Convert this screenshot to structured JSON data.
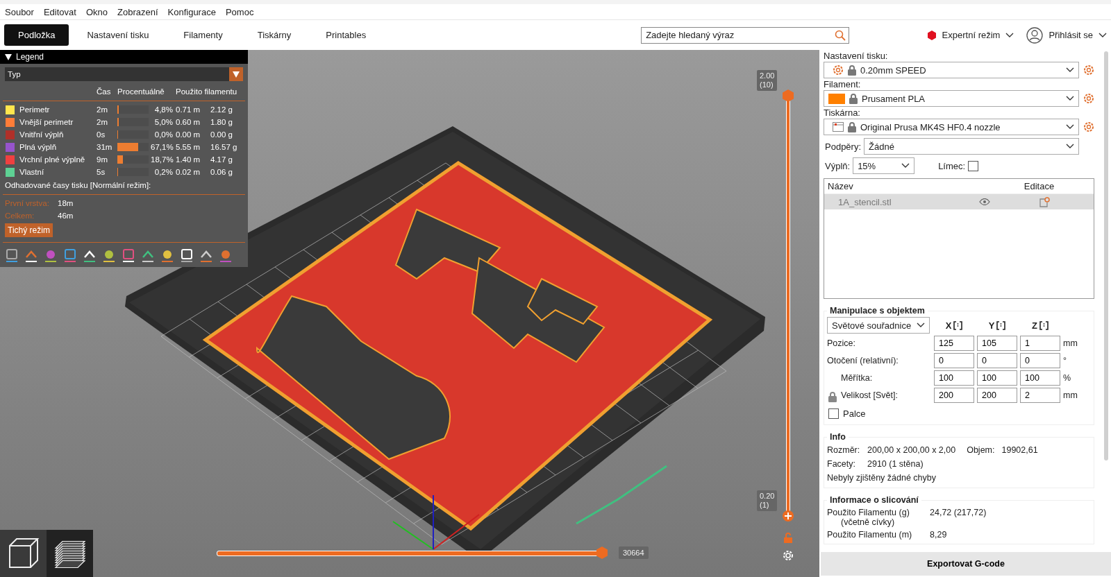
{
  "menu": [
    "Soubor",
    "Editovat",
    "Okno",
    "Zobrazení",
    "Konfigurace",
    "Pomoc"
  ],
  "tabs": [
    {
      "label": "Podložka",
      "selected": true
    },
    {
      "label": "Nastavení tisku",
      "selected": false
    },
    {
      "label": "Filamenty",
      "selected": false
    },
    {
      "label": "Tiskárny",
      "selected": false
    },
    {
      "label": "Printables",
      "selected": false
    }
  ],
  "search": {
    "placeholder": "Zadejte hledaný výraz"
  },
  "mode": {
    "label": "Expertní režim"
  },
  "login": {
    "label": "Přihlásit se"
  },
  "legend": {
    "title": "Legend",
    "view_type": "Typ",
    "columns": [
      "Čas",
      "Procentuálně",
      "Použito filamentu"
    ],
    "rows": [
      {
        "name": "Perimetr",
        "color": "#ffe64d",
        "time": "2m",
        "level": 0.048,
        "percent": "4,8%",
        "length": "0.71 m",
        "weight": "2.12 g"
      },
      {
        "name": "Vnější perimetr",
        "color": "#ff7d38",
        "time": "2m",
        "level": 0.05,
        "percent": "5,0%",
        "length": "0.60 m",
        "weight": "1.80 g"
      },
      {
        "name": "Vnitřní výplň",
        "color": "#b03029",
        "time": "0s",
        "level": 0.0,
        "percent": "0,0%",
        "length": "0.00 m",
        "weight": "0.00 g"
      },
      {
        "name": "Plná výplň",
        "color": "#9654cc",
        "time": "31m",
        "level": 0.671,
        "percent": "67,1%",
        "length": "5.55 m",
        "weight": "16.57 g"
      },
      {
        "name": "Vrchní plné výplně",
        "color": "#f04040",
        "time": "9m",
        "level": 0.187,
        "percent": "18,7%",
        "length": "1.40 m",
        "weight": "4.17 g"
      },
      {
        "name": "Vlastní",
        "color": "#5ed194",
        "time": "5s",
        "level": 0.002,
        "percent": "0,2%",
        "length": "0.02 m",
        "weight": "0.06 g"
      }
    ],
    "estimate_title": "Odhadované časy tisku [Normální režim]:",
    "times": [
      {
        "label": "První vrstva:",
        "value": "18m"
      },
      {
        "label": "Celkem:",
        "value": "46m"
      }
    ],
    "mode_button": "Tichý režim"
  },
  "layer_slider": {
    "handles": [
      {
        "level": 1,
        "label": [
          "2.00",
          "(10)"
        ]
      },
      {
        "level": 0,
        "label": [
          "0.20",
          "(1)"
        ]
      }
    ]
  },
  "move_slider": {
    "level": 1,
    "value": "30664"
  },
  "presets": [
    {
      "kind": "print",
      "label": "Nastavení tisku:",
      "value": "0.20mm SPEED"
    },
    {
      "kind": "filament",
      "label": "Filament:",
      "value": "Prusament PLA",
      "color": "#ff8000"
    },
    {
      "kind": "printer",
      "label": "Tiskárna:",
      "value": "Original Prusa MK4S HF0.4 nozzle"
    }
  ],
  "supports": {
    "label": "Podpěry:",
    "value": "Žádné"
  },
  "infill": {
    "label": "Výplň:",
    "value": "15%"
  },
  "brim": {
    "label": "Límec:",
    "checked": false
  },
  "objects": {
    "columns": [
      "Název",
      "Editace"
    ],
    "rows": [
      {
        "name": "1A_stencil.stl",
        "selected": true
      }
    ]
  },
  "manipulation": {
    "title": "Manipulace s objektem",
    "coordinates": "Světové souřadnice",
    "axes": [
      "X",
      "Y",
      "Z"
    ],
    "rows": [
      {
        "label": "Pozice:",
        "values": [
          "125",
          "105",
          "1"
        ],
        "unit": "mm"
      },
      {
        "label": "Otočení (relativní):",
        "values": [
          "0",
          "0",
          "0"
        ],
        "unit": "°"
      },
      {
        "label": "Měřítka:",
        "values": [
          "100",
          "100",
          "100"
        ],
        "unit": "%"
      },
      {
        "label": "Velikost [Svět]:",
        "values": [
          "200",
          "200",
          "2"
        ],
        "unit": "mm"
      }
    ],
    "inches": {
      "label": "Palce",
      "checked": false
    }
  },
  "info": {
    "title": "Info",
    "size_label": "Rozměr:",
    "size": "200,00 x 200,00 x 2,00",
    "volume_label": "Objem:",
    "volume": "19902,61",
    "facets_label": "Facety:",
    "facets": "2910 (1 stěna)",
    "status": "Nebyly zjištěny žádné chyby"
  },
  "slicing": {
    "title": "Informace o slicování",
    "rows": [
      {
        "label": "Použito Filamentu (g)",
        "sub": "(včetně cívky)",
        "value": "24,72 (217,72)"
      },
      {
        "label": "Použito Filamentu (m)",
        "value": "8,29"
      }
    ]
  },
  "export": "Exportovat G-code"
}
